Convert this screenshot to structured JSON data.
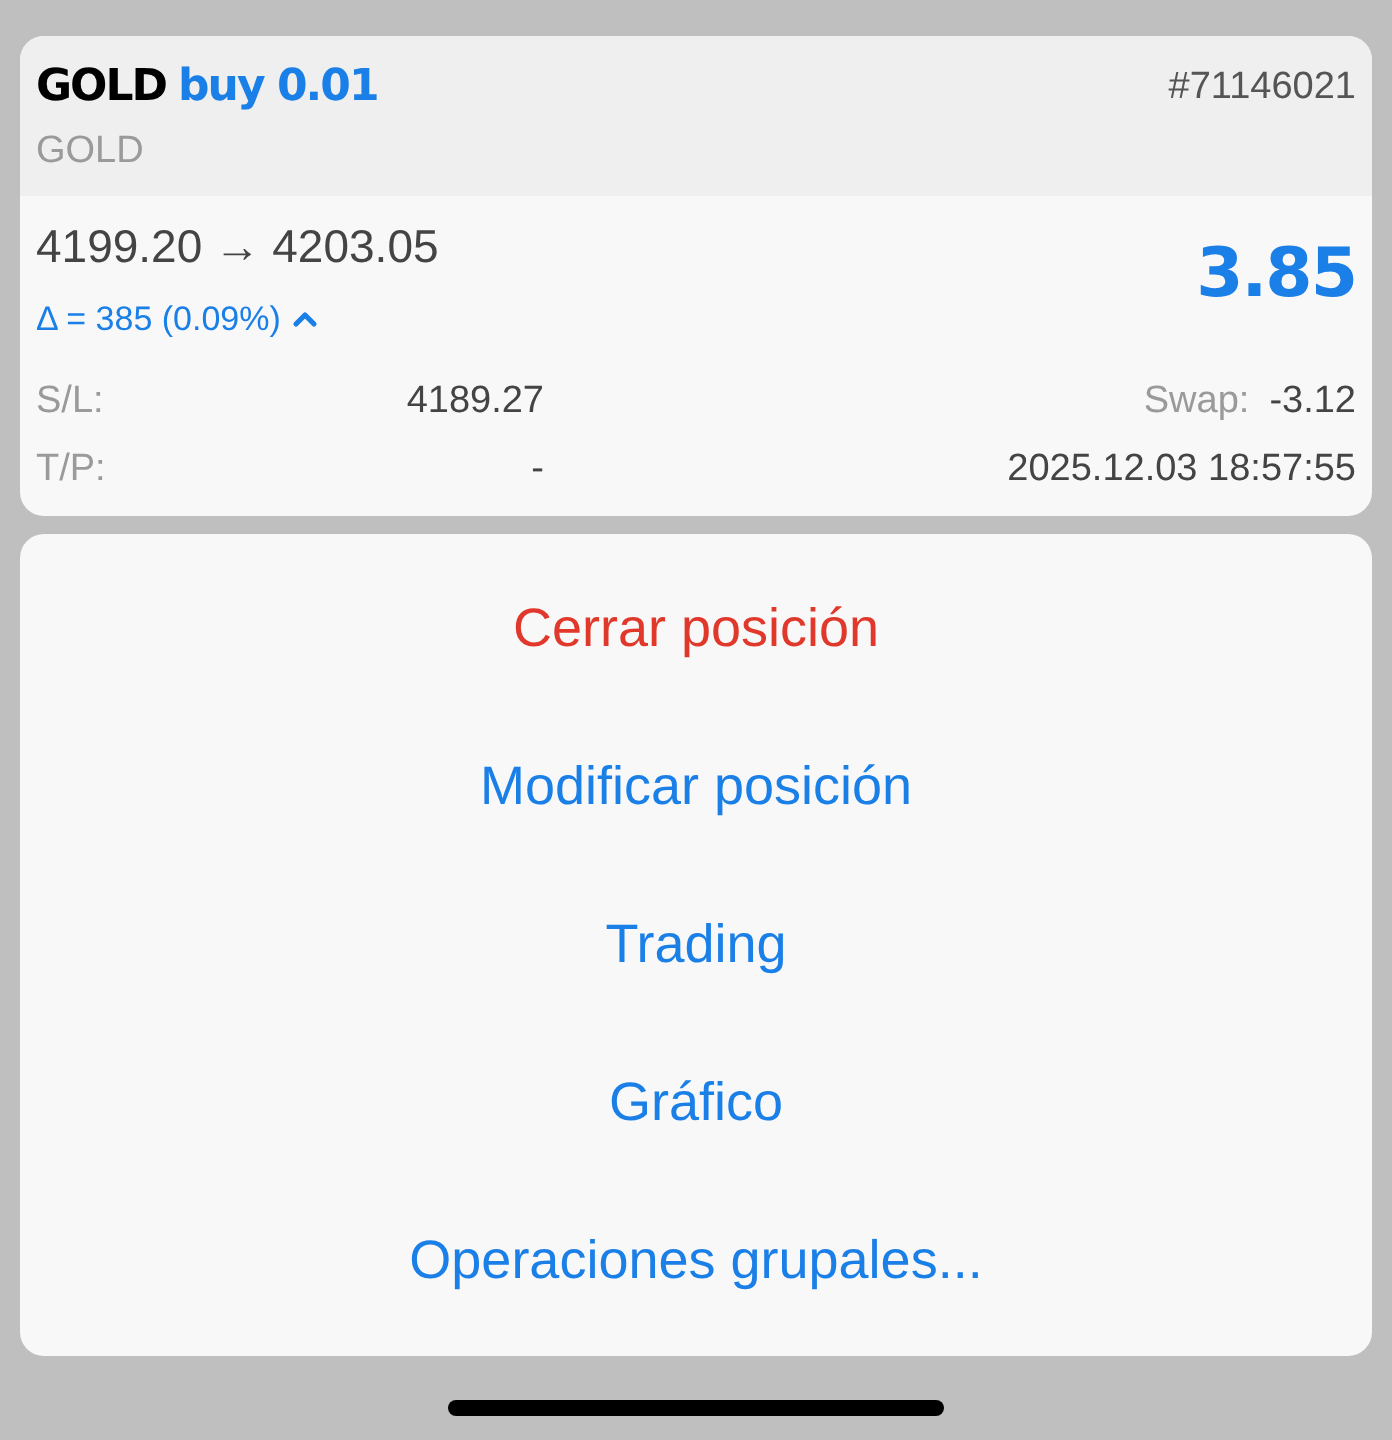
{
  "position": {
    "symbol": "GOLD",
    "side": "buy",
    "volume": "0.01",
    "ticket": "#71146021",
    "description": "GOLD",
    "price_open": "4199.20",
    "arrow": "→",
    "price_current": "4203.05",
    "delta": "Δ = 385 (0.09%)",
    "profit": "3.85",
    "sl_label": "S/L:",
    "sl_value": "4189.27",
    "swap_label": "Swap:",
    "swap_value": "-3.12",
    "tp_label": "T/P:",
    "tp_value": "-",
    "time": "2025.12.03 18:57:55"
  },
  "actions": [
    {
      "label": "Cerrar posición",
      "kind": "destructive"
    },
    {
      "label": "Modificar posición",
      "kind": "default"
    },
    {
      "label": "Trading",
      "kind": "default"
    },
    {
      "label": "Gráfico",
      "kind": "default"
    },
    {
      "label": "Operaciones grupales...",
      "kind": "default"
    }
  ]
}
